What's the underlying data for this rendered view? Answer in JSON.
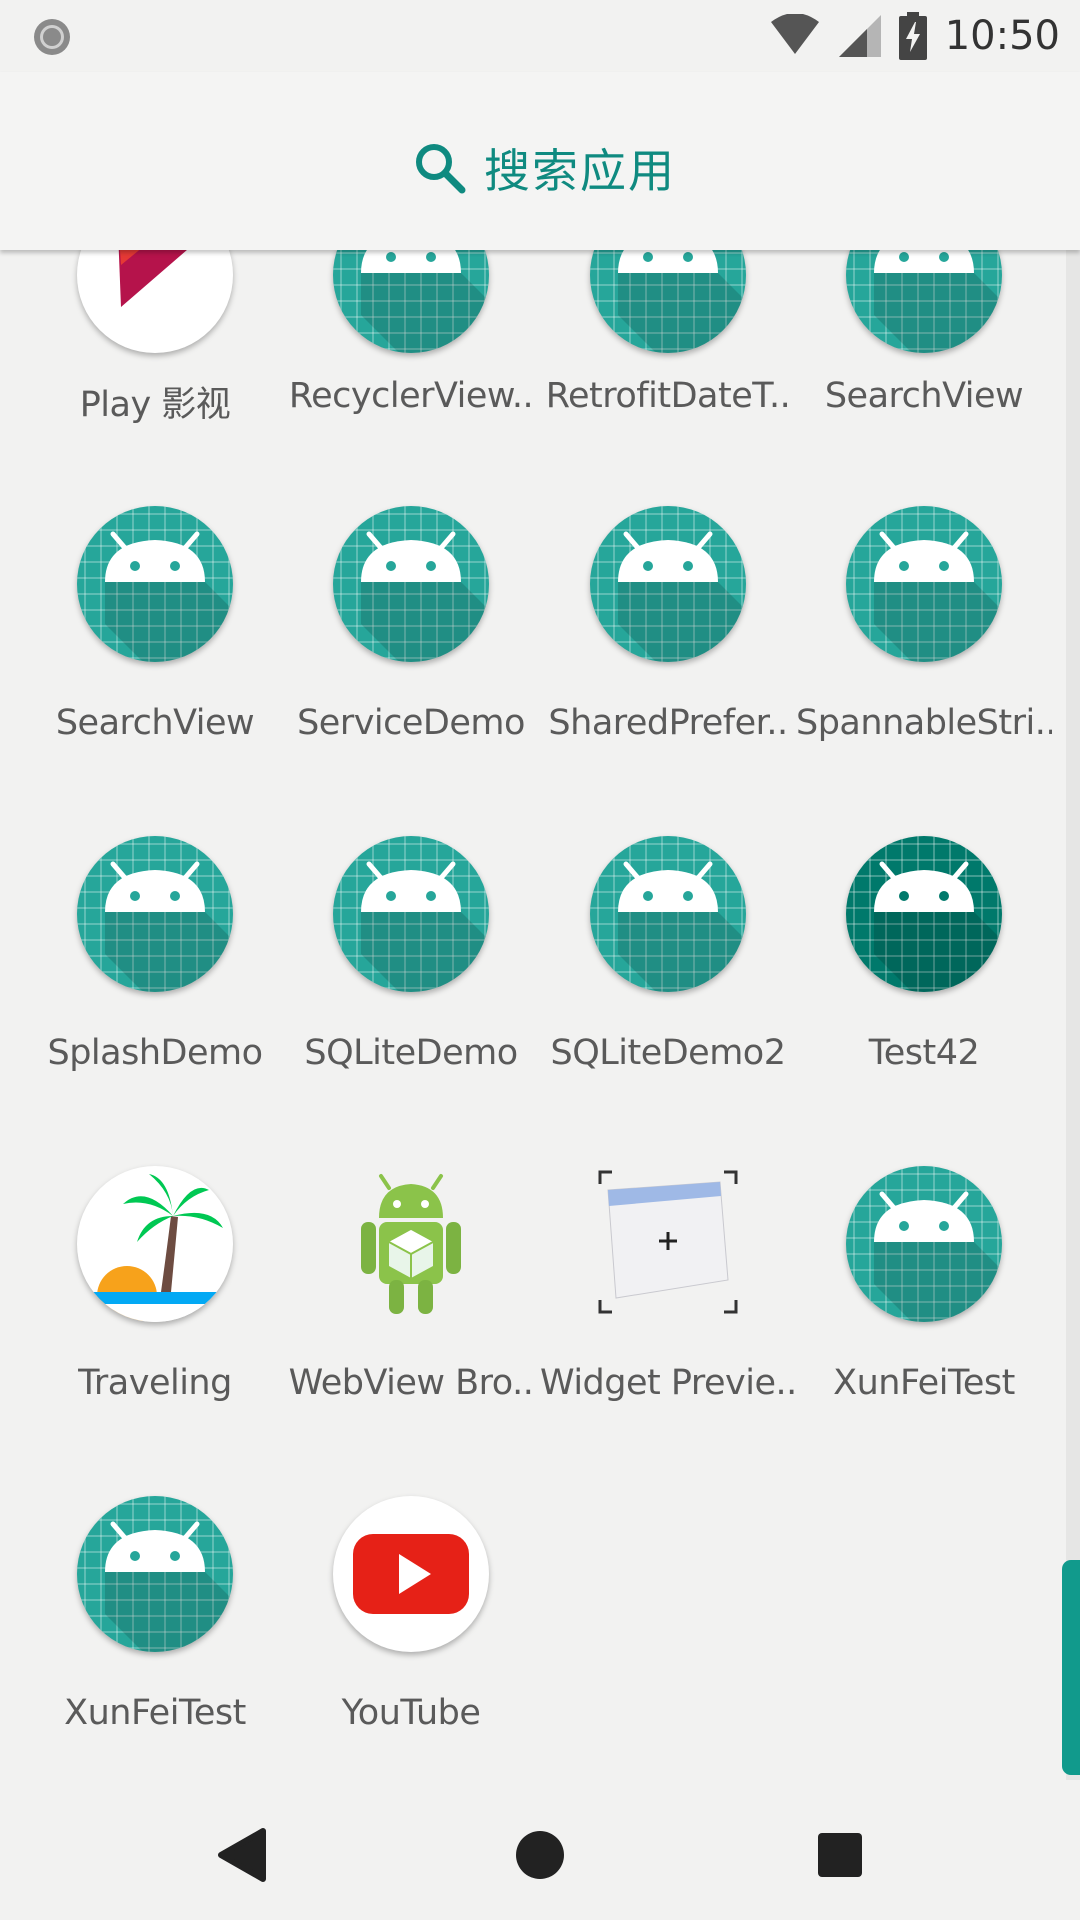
{
  "status_bar": {
    "time": "10:50",
    "icons": [
      "recording-dot-icon",
      "wifi-icon",
      "cell-signal-icon",
      "battery-charging-icon"
    ]
  },
  "search": {
    "label": "搜索应用",
    "icon": "search-icon",
    "color": "#0f8a80"
  },
  "apps": [
    {
      "label": "Play 影视",
      "icon": "play-movies-icon"
    },
    {
      "label": "RecyclerView..",
      "icon": "android-default-icon"
    },
    {
      "label": "RetrofitDateT..",
      "icon": "android-default-icon"
    },
    {
      "label": "SearchView",
      "icon": "android-default-icon"
    },
    {
      "label": "SearchView",
      "icon": "android-default-icon"
    },
    {
      "label": "ServiceDemo",
      "icon": "android-default-icon"
    },
    {
      "label": "SharedPrefer..",
      "icon": "android-default-icon"
    },
    {
      "label": "SpannableStri..",
      "icon": "android-default-icon"
    },
    {
      "label": "SplashDemo",
      "icon": "android-default-icon"
    },
    {
      "label": "SQLiteDemo",
      "icon": "android-default-icon"
    },
    {
      "label": "SQLiteDemo2",
      "icon": "android-default-icon"
    },
    {
      "label": "Test42",
      "icon": "android-default-dark-icon"
    },
    {
      "label": "Traveling",
      "icon": "palm-beach-icon"
    },
    {
      "label": "WebView Bro..",
      "icon": "android-robot-box-icon"
    },
    {
      "label": "Widget Previe..",
      "icon": "widget-preview-icon"
    },
    {
      "label": "XunFeiTest",
      "icon": "android-default-icon"
    },
    {
      "label": "XunFeiTest",
      "icon": "android-default-icon"
    },
    {
      "label": "YouTube",
      "icon": "youtube-icon"
    }
  ],
  "nav_bar": {
    "icons": [
      "back-icon",
      "home-icon",
      "recents-icon"
    ]
  },
  "colors": {
    "accent": "#119a8c",
    "android_teal": "#26a69a",
    "android_dark_teal": "#00796b",
    "background": "#f2f2f1"
  }
}
